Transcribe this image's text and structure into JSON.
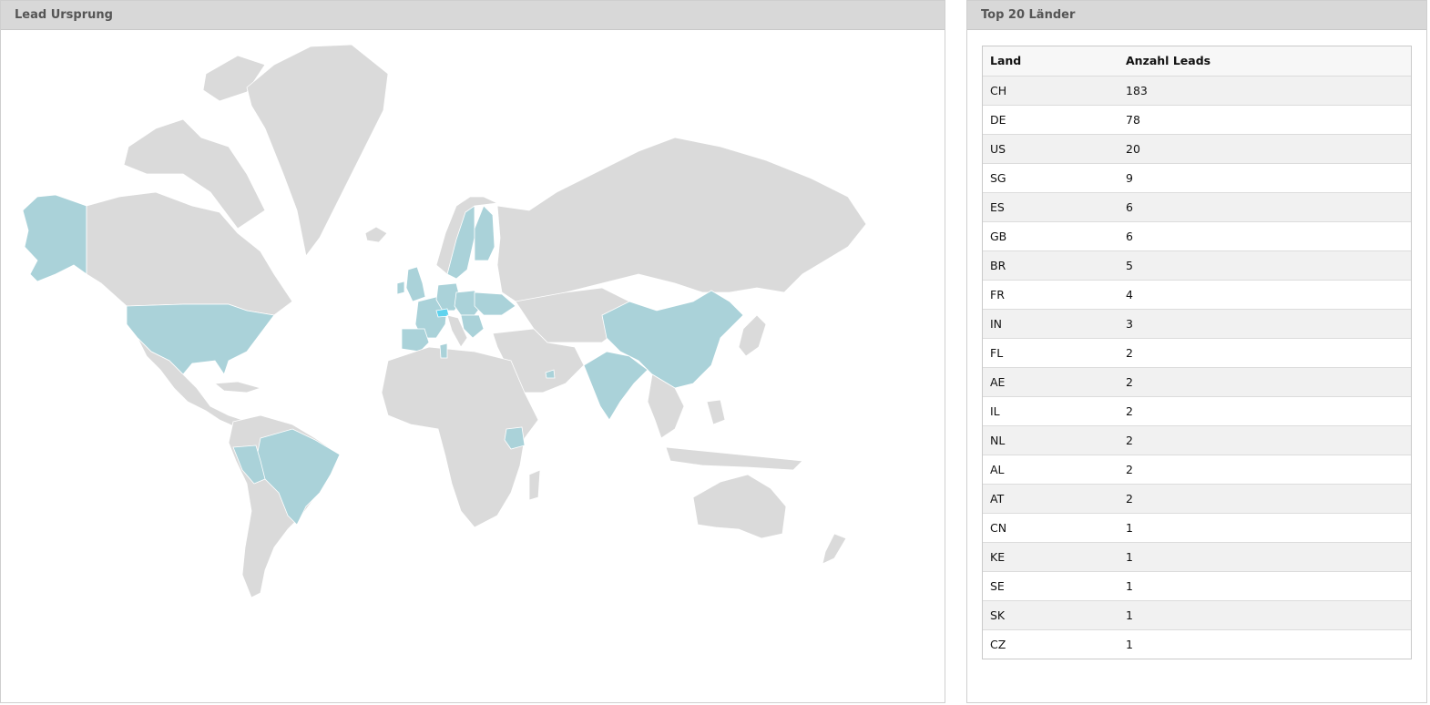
{
  "map_panel": {
    "title": "Lead Ursprung",
    "highlight_color": "#aad2d9",
    "top_color": "#5fd3ee",
    "base_color": "#dadada"
  },
  "table_panel": {
    "title": "Top 20 Länder",
    "columns": [
      "Land",
      "Anzahl Leads"
    ],
    "rows": [
      [
        "CH",
        "183"
      ],
      [
        "DE",
        "78"
      ],
      [
        "US",
        "20"
      ],
      [
        "SG",
        "9"
      ],
      [
        "ES",
        "6"
      ],
      [
        "GB",
        "6"
      ],
      [
        "BR",
        "5"
      ],
      [
        "FR",
        "4"
      ],
      [
        "IN",
        "3"
      ],
      [
        "FL",
        "2"
      ],
      [
        "AE",
        "2"
      ],
      [
        "IL",
        "2"
      ],
      [
        "NL",
        "2"
      ],
      [
        "AL",
        "2"
      ],
      [
        "AT",
        "2"
      ],
      [
        "CN",
        "1"
      ],
      [
        "KE",
        "1"
      ],
      [
        "SE",
        "1"
      ],
      [
        "SK",
        "1"
      ],
      [
        "CZ",
        "1"
      ]
    ]
  }
}
